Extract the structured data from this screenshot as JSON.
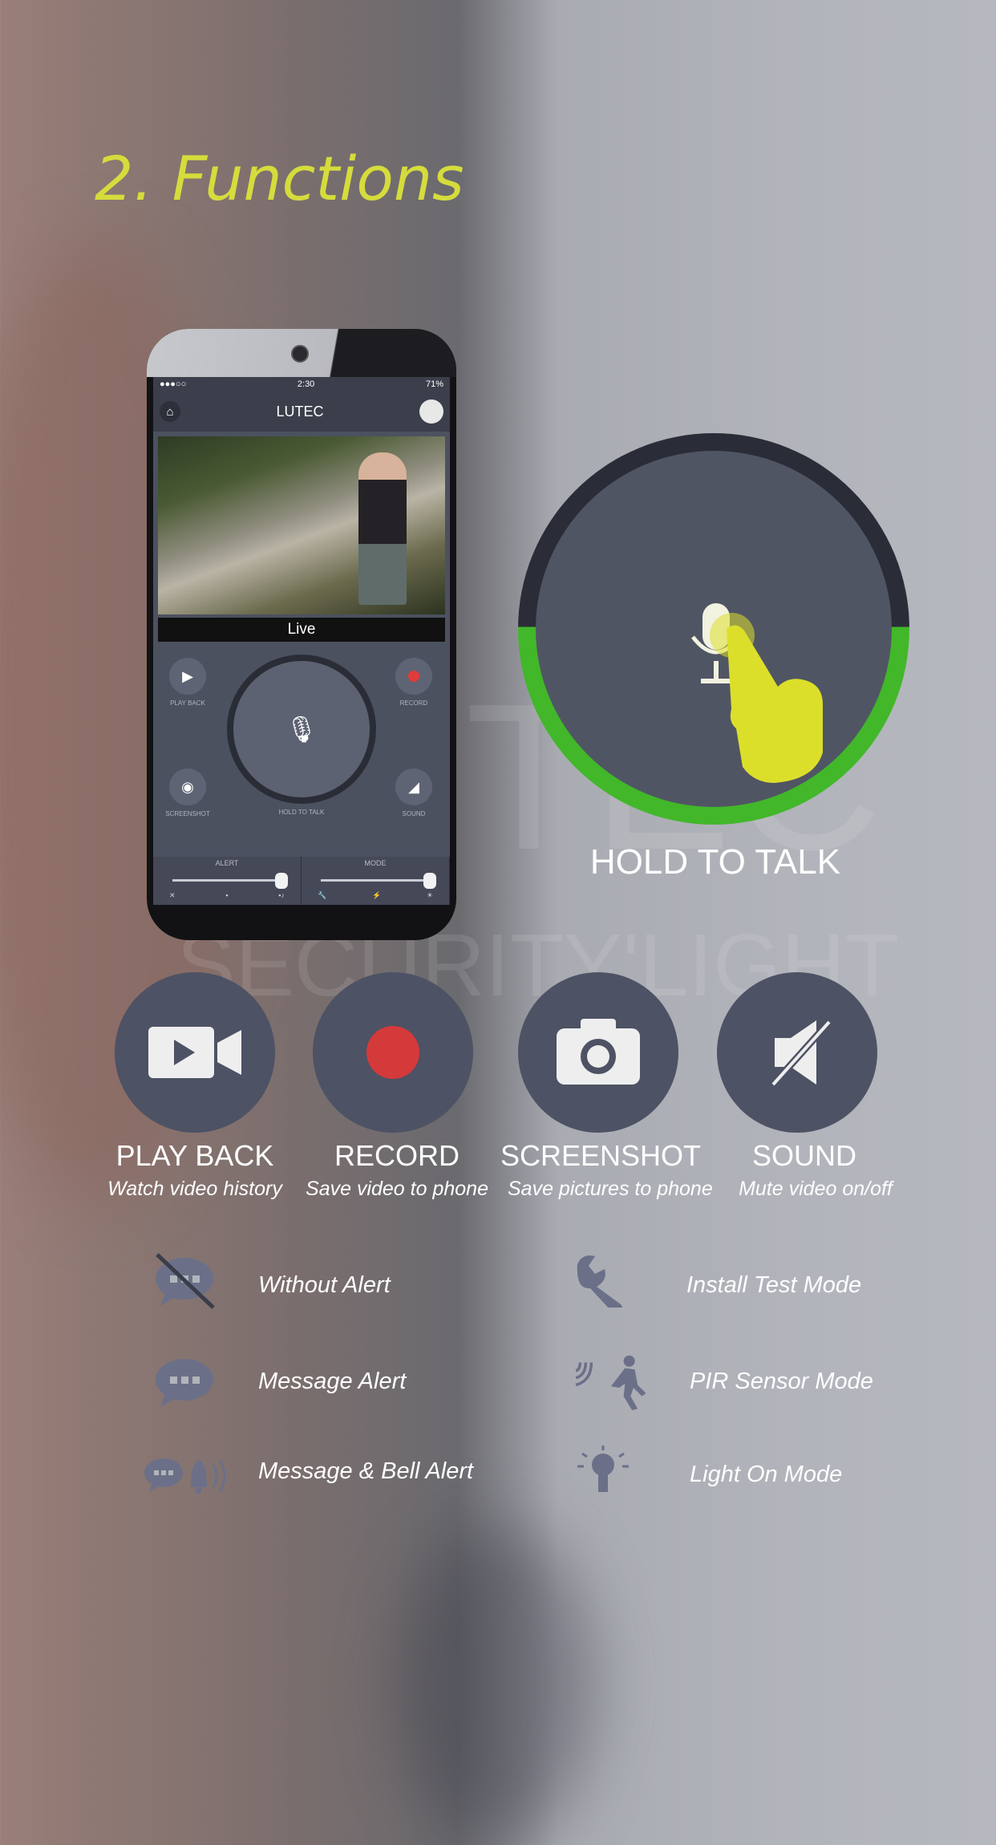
{
  "page_title": "2. Functions",
  "watermark": {
    "line1": "TEC",
    "line2": "SECURITY'LIGHT"
  },
  "phone": {
    "status_time": "2:30",
    "status_battery": "71%",
    "app_title": "LUTEC",
    "live_label": "Live",
    "buttons": {
      "playback": "PLAY BACK",
      "record": "RECORD",
      "screenshot": "SCREENSHOT",
      "hold_to_talk": "HOLD TO TALK",
      "sound": "SOUND"
    },
    "sliders": {
      "alert": "ALERT",
      "mode": "MODE"
    }
  },
  "hold_to_talk": {
    "label": "HOLD TO TALK"
  },
  "functions": [
    {
      "title": "PLAY BACK",
      "subtitle": "Watch video history",
      "icon": "video-camera-icon"
    },
    {
      "title": "RECORD",
      "subtitle": "Save video to phone",
      "icon": "record-dot-icon"
    },
    {
      "title": "SCREENSHOT",
      "subtitle": "Save pictures to phone",
      "icon": "camera-icon"
    },
    {
      "title": "SOUND",
      "subtitle": "Mute video on/off",
      "icon": "mute-speaker-icon"
    }
  ],
  "alert_modes": [
    {
      "label": "Without Alert",
      "icon": "no-message-icon"
    },
    {
      "label": "Message Alert",
      "icon": "message-icon"
    },
    {
      "label": "Message & Bell Alert",
      "icon": "message-bell-icon"
    }
  ],
  "sensor_modes": [
    {
      "label": "Install Test Mode",
      "icon": "wrench-icon"
    },
    {
      "label": "PIR Sensor Mode",
      "icon": "motion-sensor-icon"
    },
    {
      "label": "Light On Mode",
      "icon": "light-bulb-icon"
    }
  ],
  "colors": {
    "title": "#d5dc3c",
    "accent_green": "#42b72a",
    "button_bg": "#4d5264",
    "record_red": "#d53a3a",
    "hand_yellow": "#dcdf2a"
  }
}
